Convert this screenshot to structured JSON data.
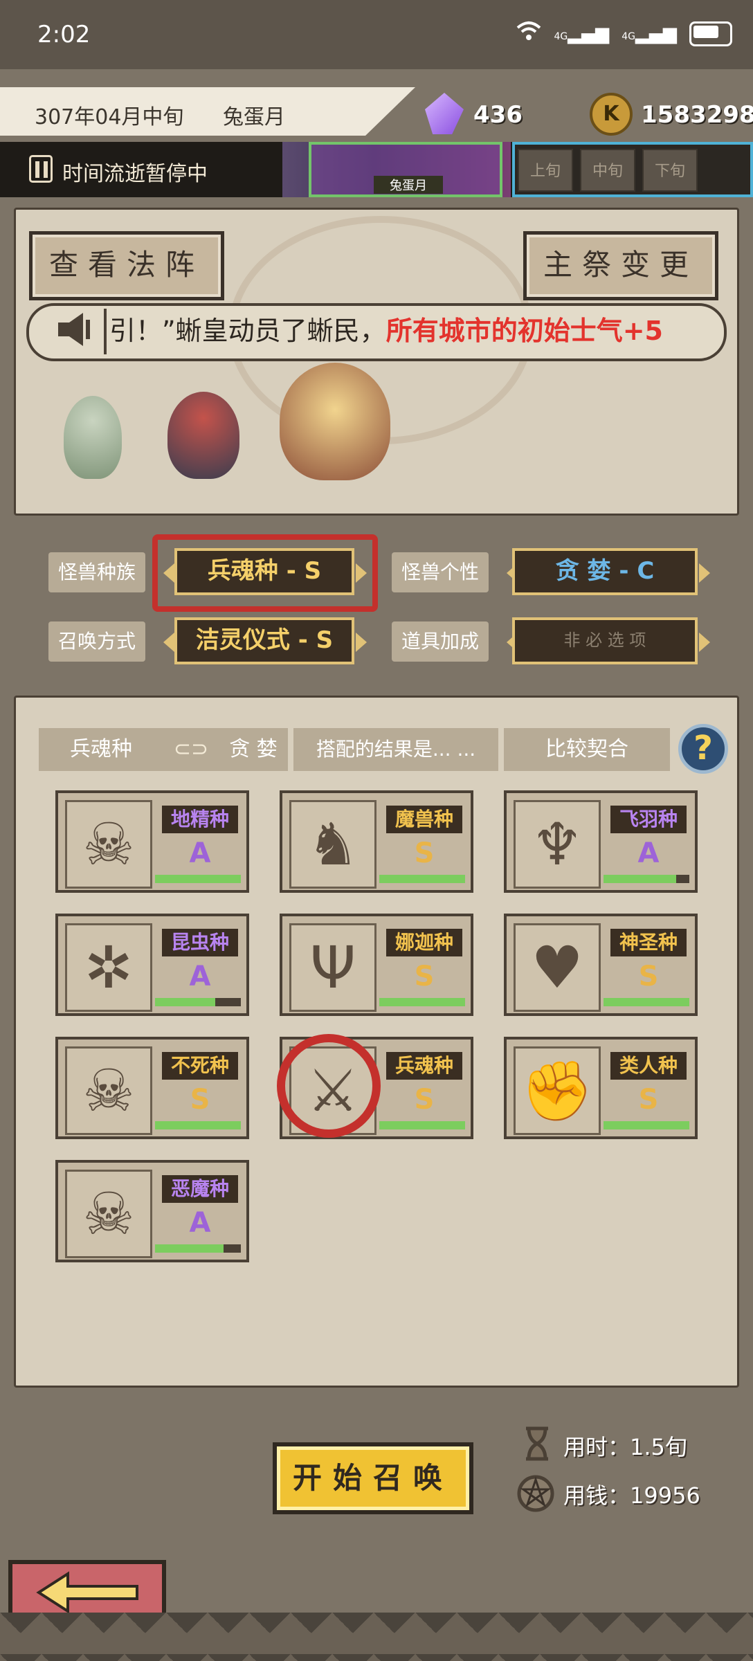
{
  "status_bar": {
    "time": "2:02",
    "network": "4G",
    "network2": "4G"
  },
  "header": {
    "date": "307年04月中旬",
    "month_name": "兔蛋月",
    "crystals": "436",
    "coins": "1583298",
    "coin_glyph": "K",
    "time_status": "时间流逝暂停中",
    "current_month_label": "兔蛋月",
    "periods": [
      "上旬",
      "中旬",
      "下旬"
    ]
  },
  "upper": {
    "view_array_button": "查看法阵",
    "change_priest_button": "主祭变更",
    "ticker_prefix": "引！”蜥皇动员了蜥民，",
    "ticker_highlight": "所有城市的初始士气+5"
  },
  "selectors": {
    "race_label": "怪兽种族",
    "race_value": "兵魂种 - S",
    "personality_label": "怪兽个性",
    "personality_value": "贪 婪 - C",
    "method_label": "召唤方式",
    "method_value": "洁灵仪式 - S",
    "item_label": "道具加成",
    "item_value": "非 必 选 项"
  },
  "combo": {
    "race": "兵魂种",
    "link_glyph": "⊂⊃",
    "personality": "贪 婪",
    "result_label": "搭配的结果是... ...",
    "result": "比较契合",
    "help_glyph": "?"
  },
  "race_cards": [
    {
      "name": "地精种",
      "grade": "A",
      "progress": 1.0,
      "glyph": "☠"
    },
    {
      "name": "魔兽种",
      "grade": "S",
      "progress": 1.0,
      "glyph": "♞"
    },
    {
      "name": "飞羽种",
      "grade": "A",
      "progress": 0.85,
      "glyph": "♆"
    },
    {
      "name": "昆虫种",
      "grade": "A",
      "progress": 0.7,
      "glyph": "✲"
    },
    {
      "name": "娜迦种",
      "grade": "S",
      "progress": 1.0,
      "glyph": "Ψ"
    },
    {
      "name": "神圣种",
      "grade": "S",
      "progress": 1.0,
      "glyph": "♥"
    },
    {
      "name": "不死种",
      "grade": "S",
      "progress": 1.0,
      "glyph": "☠"
    },
    {
      "name": "兵魂种",
      "grade": "S",
      "progress": 1.0,
      "glyph": "⚔"
    },
    {
      "name": "类人种",
      "grade": "S",
      "progress": 1.0,
      "glyph": "✊"
    },
    {
      "name": "恶魔种",
      "grade": "A",
      "progress": 0.8,
      "glyph": "☠"
    }
  ],
  "footer": {
    "start_button": "开始召唤",
    "time_cost": "用时：1.5旬",
    "money_cost": "用钱：19956"
  },
  "colors": {
    "accent_gold": "#f0c233",
    "highlight_red": "#c4302c",
    "ticker_red": "#e3332d"
  }
}
